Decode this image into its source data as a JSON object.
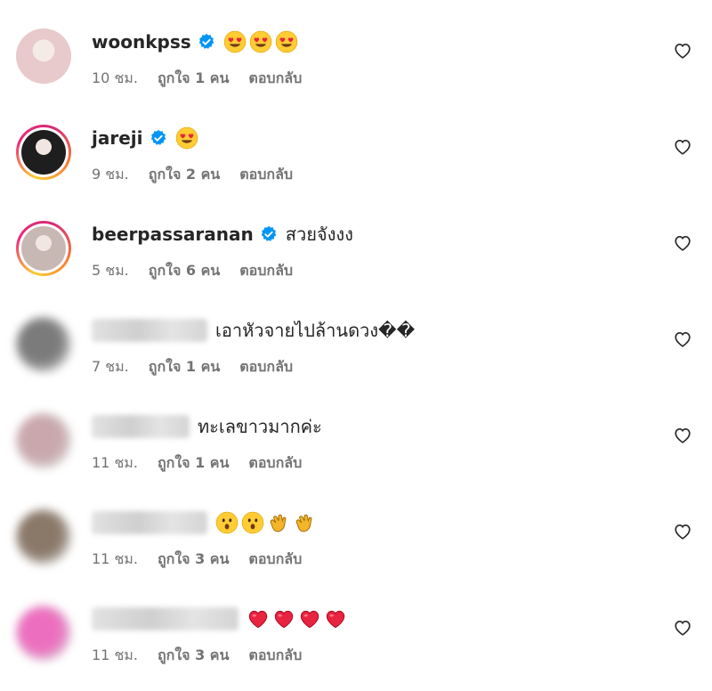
{
  "comments": [
    {
      "username": "woonkpss",
      "verified": true,
      "text": "",
      "emojis": [
        "heart-eyes",
        "heart-eyes",
        "heart-eyes"
      ],
      "time": "10 ชม.",
      "likes": "ถูกใจ 1 คน",
      "reply": "ตอบกลับ",
      "avatar_ring": false,
      "blurred": false,
      "avatar_color": "#e8c9cc"
    },
    {
      "username": "jareji",
      "verified": true,
      "text": "",
      "emojis": [
        "heart-eyes"
      ],
      "time": "9 ชม.",
      "likes": "ถูกใจ 2 คน",
      "reply": "ตอบกลับ",
      "avatar_ring": true,
      "blurred": false,
      "avatar_color": "#1e1e1e"
    },
    {
      "username": "beerpassaranan",
      "verified": true,
      "text": "สวยจังงง",
      "emojis": [],
      "time": "5 ชม.",
      "likes": "ถูกใจ 6 คน",
      "reply": "ตอบกลับ",
      "avatar_ring": true,
      "blurred": false,
      "avatar_color": "#c7b8b4"
    },
    {
      "username": "",
      "verified": false,
      "text": "เอาหัวจายไปล้านดวง��",
      "emojis": [],
      "time": "7 ชม.",
      "likes": "ถูกใจ 1 คน",
      "reply": "ตอบกลับ",
      "avatar_ring": false,
      "blurred": true,
      "avatar_color": "#7b7b7b"
    },
    {
      "username": "",
      "verified": false,
      "text": "ทะเลขาวมากค่ะ",
      "emojis": [],
      "time": "11 ชม.",
      "likes": "ถูกใจ 1 คน",
      "reply": "ตอบกลับ",
      "avatar_ring": false,
      "blurred": true,
      "avatar_color": "#c9a7ad"
    },
    {
      "username": "",
      "verified": false,
      "text": "",
      "emojis": [
        "astonished",
        "astonished",
        "clap",
        "clap"
      ],
      "time": "11 ชม.",
      "likes": "ถูกใจ 3 คน",
      "reply": "ตอบกลับ",
      "avatar_ring": false,
      "blurred": true,
      "avatar_color": "#8a7868"
    },
    {
      "username": "",
      "verified": false,
      "text": "",
      "emojis": [
        "red-heart",
        "red-heart",
        "red-heart",
        "red-heart"
      ],
      "time": "11 ชม.",
      "likes": "ถูกใจ 3 คน",
      "reply": "ตอบกลับ",
      "avatar_ring": false,
      "blurred": true,
      "avatar_color": "#ec6fbf"
    }
  ],
  "colors": {
    "text": "#262626",
    "secondary": "#737373",
    "verified": "#0095f6"
  }
}
